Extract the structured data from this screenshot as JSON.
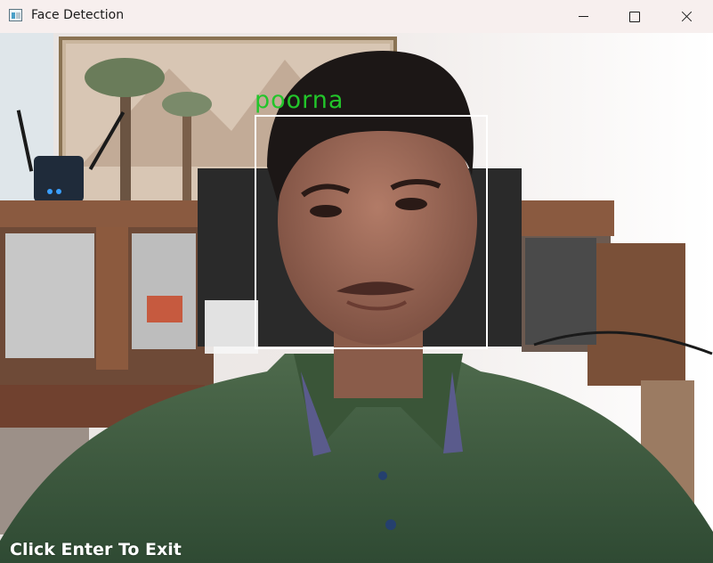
{
  "window": {
    "title": "Face Detection",
    "icon": "python-window-icon",
    "controls": [
      "minimize",
      "maximize",
      "close"
    ]
  },
  "camera": {
    "detected_name": "poorna",
    "box_color": "#ffffff",
    "label_color": "#22c52a",
    "instruction": "Click Enter To Exit"
  }
}
